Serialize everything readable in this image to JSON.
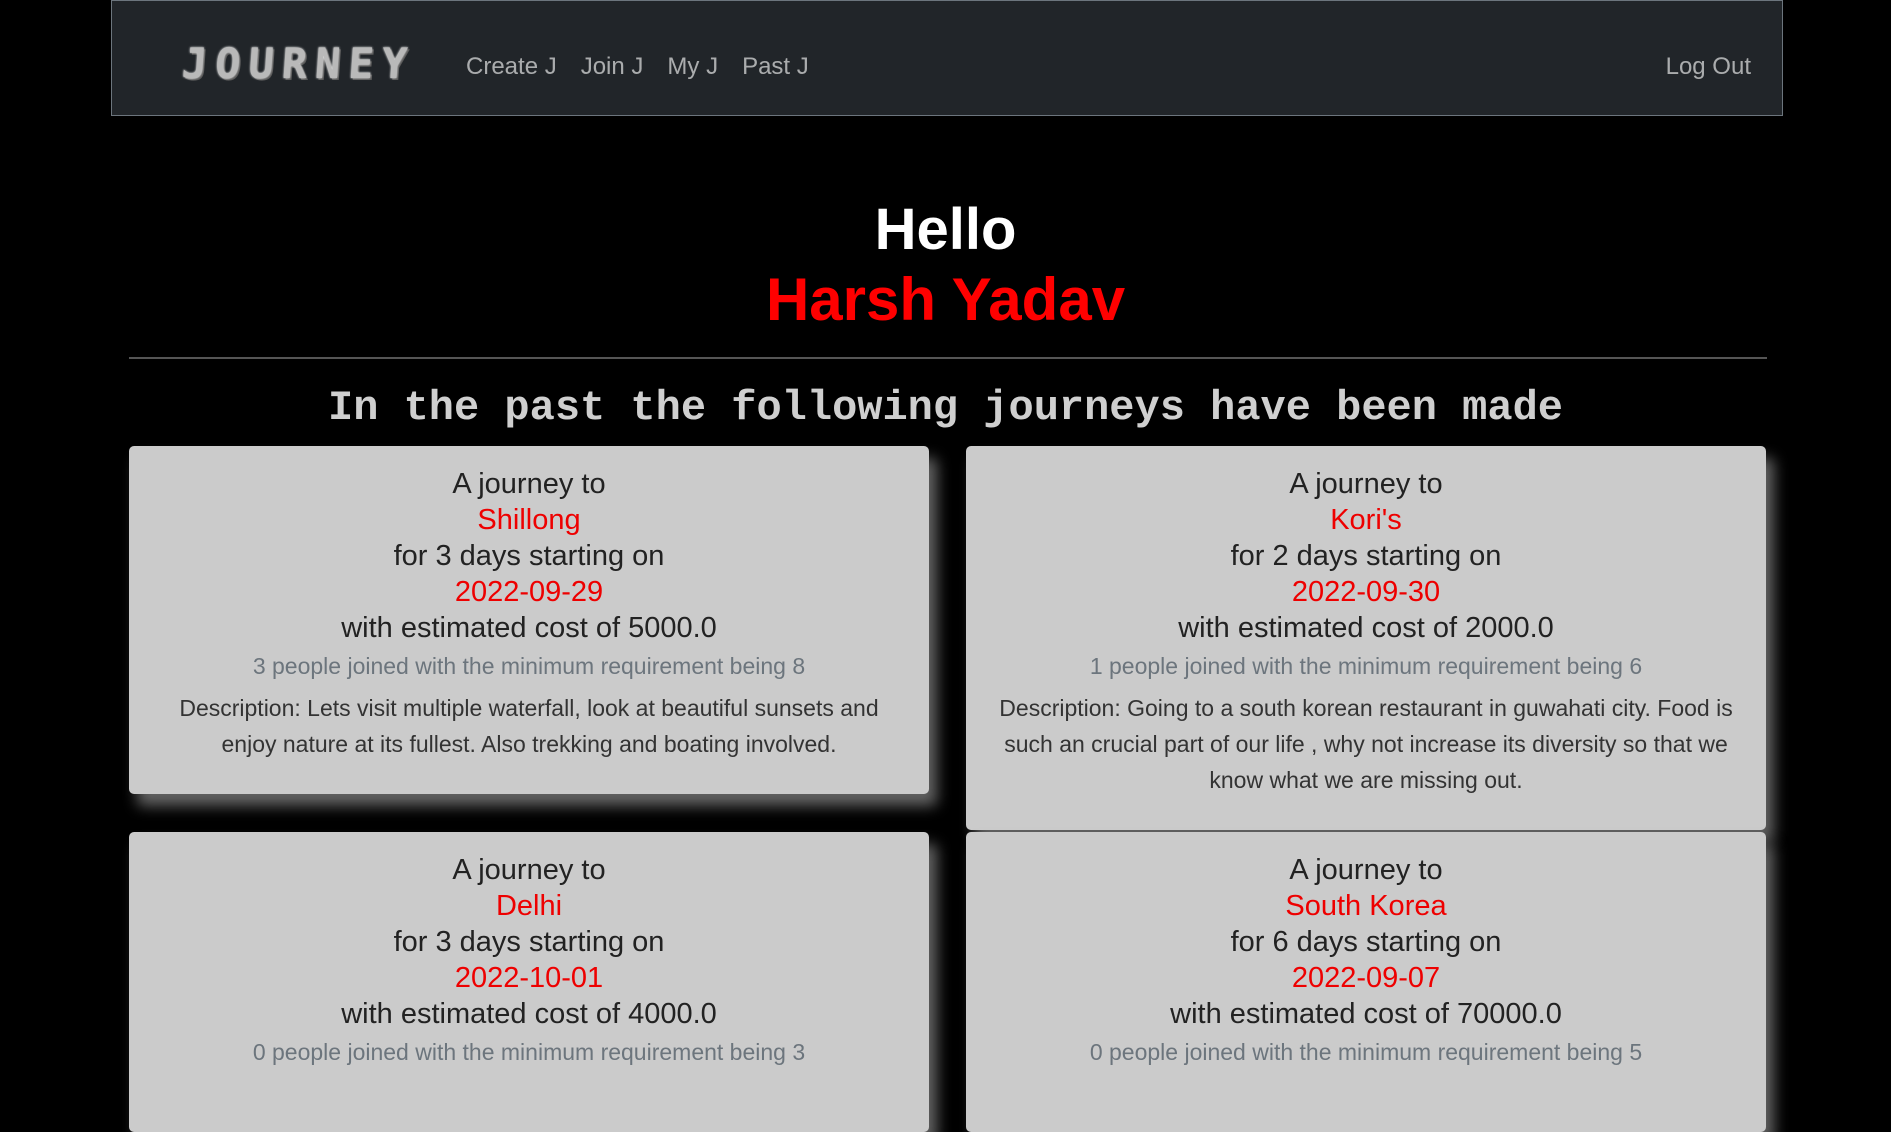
{
  "navbar": {
    "logo_text": "JOURNEY",
    "links": [
      {
        "label": "Create J"
      },
      {
        "label": "Join J"
      },
      {
        "label": "My J"
      },
      {
        "label": "Past J"
      }
    ],
    "logout_label": "Log Out"
  },
  "greeting": {
    "hello": "Hello",
    "username": "Harsh Yadav"
  },
  "section_heading": "In the past the following journeys have been made",
  "journeys": [
    {
      "intro": "A journey to",
      "destination": "Shillong",
      "duration": "for 3 days starting on",
      "start_date": "2022-09-29",
      "cost": "with estimated cost of 5000.0",
      "people": "3 people joined with the minimum requirement being 8",
      "description": "Description: Lets visit multiple waterfall, look at beautiful sunsets and enjoy nature at its fullest. Also trekking and boating involved."
    },
    {
      "intro": "A journey to",
      "destination": "Kori's",
      "duration": "for 2 days starting on",
      "start_date": "2022-09-30",
      "cost": "with estimated cost of 2000.0",
      "people": "1 people joined with the minimum requirement being 6",
      "description": "Description: Going to a south korean restaurant in guwahati city. Food is such an crucial part of our life , why not increase its diversity so that we know what we are missing out."
    },
    {
      "intro": "A journey to",
      "destination": "Delhi",
      "duration": "for 3 days starting on",
      "start_date": "2022-10-01",
      "cost": "with estimated cost of 4000.0",
      "people": "0 people joined with the minimum requirement being 3",
      "description": ""
    },
    {
      "intro": "A journey to",
      "destination": "South Korea",
      "duration": "for 6 days starting on",
      "start_date": "2022-09-07",
      "cost": "with estimated cost of 70000.0",
      "people": "0 people joined with the minimum requirement being 5",
      "description": ""
    }
  ],
  "colors": {
    "background": "#000000",
    "navbar": "#212529",
    "accent_red": "#ff0000",
    "card": "#cbcbcb",
    "muted": "#6c757d"
  }
}
